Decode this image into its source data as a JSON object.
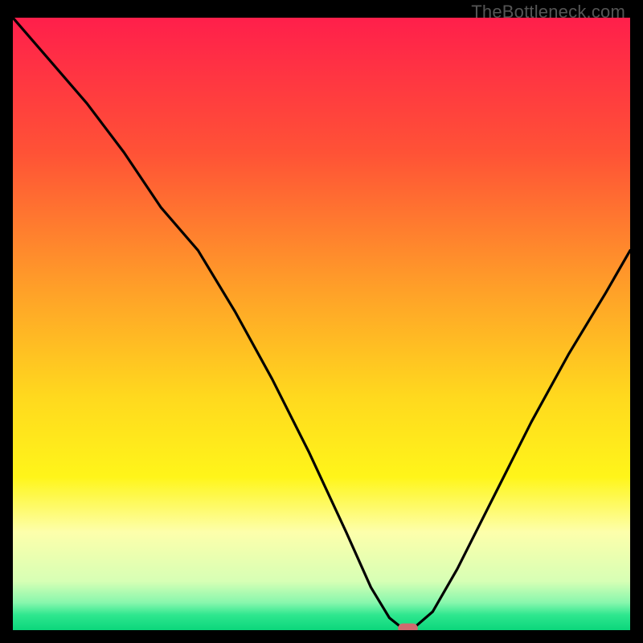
{
  "watermark": "TheBottleneck.com",
  "chart_data": {
    "type": "line",
    "title": "",
    "xlabel": "",
    "ylabel": "",
    "xlim": [
      0,
      100
    ],
    "ylim": [
      0,
      100
    ],
    "grid": false,
    "legend": false,
    "background_gradient": {
      "stops": [
        {
          "offset": 0.0,
          "color": "#ff1f4b"
        },
        {
          "offset": 0.22,
          "color": "#ff5236"
        },
        {
          "offset": 0.45,
          "color": "#ffa228"
        },
        {
          "offset": 0.62,
          "color": "#ffd91e"
        },
        {
          "offset": 0.75,
          "color": "#fff51a"
        },
        {
          "offset": 0.84,
          "color": "#fdffab"
        },
        {
          "offset": 0.92,
          "color": "#d7ffb5"
        },
        {
          "offset": 0.955,
          "color": "#88f7ad"
        },
        {
          "offset": 0.975,
          "color": "#2fe78f"
        },
        {
          "offset": 1.0,
          "color": "#0bd67b"
        }
      ]
    },
    "series": [
      {
        "name": "bottleneck-curve",
        "color": "#000000",
        "x": [
          0,
          6,
          12,
          18,
          24,
          30,
          36,
          42,
          48,
          54,
          58,
          61,
          63,
          65,
          68,
          72,
          78,
          84,
          90,
          96,
          100
        ],
        "y": [
          100,
          93,
          86,
          78,
          69,
          62,
          52,
          41,
          29,
          16,
          7,
          2,
          0.4,
          0.4,
          3,
          10,
          22,
          34,
          45,
          55,
          62
        ]
      }
    ],
    "marker": {
      "name": "optimal-point-marker",
      "shape": "capsule",
      "color": "#d06a6f",
      "x_center": 64,
      "y_center": 0.3,
      "width_pct": 3.2,
      "height_pct": 1.6
    }
  }
}
